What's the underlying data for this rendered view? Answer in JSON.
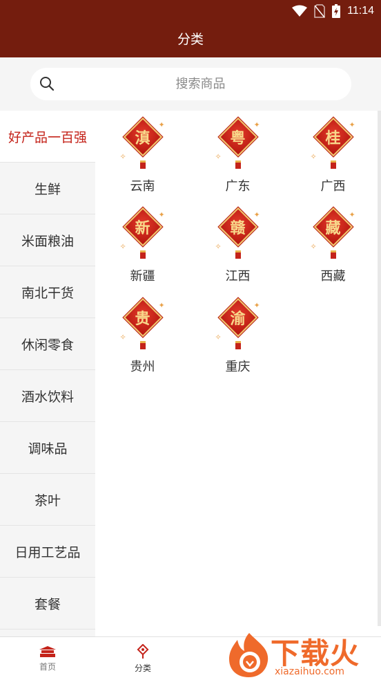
{
  "status_bar": {
    "time": "11:14"
  },
  "header": {
    "title": "分类"
  },
  "search": {
    "placeholder": "搜索商品"
  },
  "sidebar": {
    "items": [
      {
        "label": "好产品一百强",
        "active": true
      },
      {
        "label": "生鲜"
      },
      {
        "label": "米面粮油"
      },
      {
        "label": "南北干货"
      },
      {
        "label": "休闲零食"
      },
      {
        "label": "酒水饮料"
      },
      {
        "label": "调味品"
      },
      {
        "label": "茶叶"
      },
      {
        "label": "日用工艺品"
      },
      {
        "label": "套餐"
      }
    ]
  },
  "grid": {
    "items": [
      {
        "char": "滇",
        "label": "云南"
      },
      {
        "char": "粤",
        "label": "广东"
      },
      {
        "char": "桂",
        "label": "广西"
      },
      {
        "char": "新",
        "label": "新疆"
      },
      {
        "char": "赣",
        "label": "江西"
      },
      {
        "char": "藏",
        "label": "西藏"
      },
      {
        "char": "贵",
        "label": "贵州"
      },
      {
        "char": "渝",
        "label": "重庆"
      }
    ]
  },
  "bottom_nav": {
    "items": [
      {
        "label": "首页",
        "icon": "temple-icon"
      },
      {
        "label": "分类",
        "icon": "chinese-knot-icon",
        "active": true
      }
    ]
  },
  "watermark": {
    "title": "下载火",
    "subtitle": "xiazaihuo.com"
  },
  "colors": {
    "header_bg": "#741d0e",
    "accent": "#c4231a",
    "knot_gold": "#f8d98b",
    "watermark": "#ef6a2b"
  }
}
